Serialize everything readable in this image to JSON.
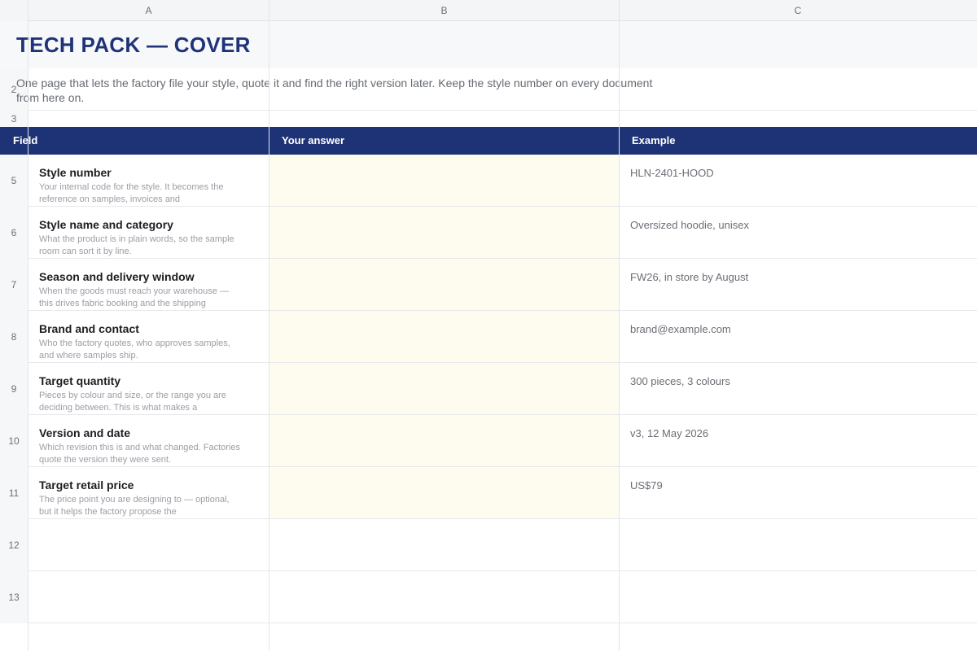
{
  "columns": [
    "A",
    "B",
    "C"
  ],
  "title": "TECH PACK — COVER",
  "intro": "One page that lets the factory file your style, quote it and find the right version later. Keep the style number on every document from here on.",
  "row_numbers": {
    "intro": "2",
    "blank": "3",
    "empty": [
      "12",
      "13"
    ]
  },
  "header": {
    "field": "Field",
    "answer": "Your answer",
    "example": "Example"
  },
  "rows": [
    {
      "num": "5",
      "field": "Style number",
      "help": "Your internal code for the style. It becomes the reference on samples, invoices and",
      "answer": "",
      "example": "HLN-2401-HOOD"
    },
    {
      "num": "6",
      "field": "Style name and category",
      "help": "What the product is in plain words, so the sample room can sort it by line.",
      "answer": "",
      "example": "Oversized hoodie, unisex"
    },
    {
      "num": "7",
      "field": "Season and delivery window",
      "help": "When the goods must reach your warehouse — this drives fabric booking and the shipping",
      "answer": "",
      "example": "FW26, in store by August"
    },
    {
      "num": "8",
      "field": "Brand and contact",
      "help": "Who the factory quotes, who approves samples, and where samples ship.",
      "answer": "",
      "example": "brand@example.com"
    },
    {
      "num": "9",
      "field": "Target quantity",
      "help": "Pieces by colour and size, or the range you are deciding between. This is what makes a",
      "answer": "",
      "example": "300 pieces, 3 colours"
    },
    {
      "num": "10",
      "field": "Version and date",
      "help": "Which revision this is and what changed. Factories quote the version they were sent.",
      "answer": "",
      "example": "v3, 12 May 2026"
    },
    {
      "num": "11",
      "field": "Target retail price",
      "help": "The price point you are designing to — optional, but it helps the factory propose the",
      "answer": "",
      "example": "US$79"
    }
  ],
  "colors": {
    "title": "#1f3478",
    "header_band": "#1e3375",
    "answer_fill": "#fdfcef"
  }
}
